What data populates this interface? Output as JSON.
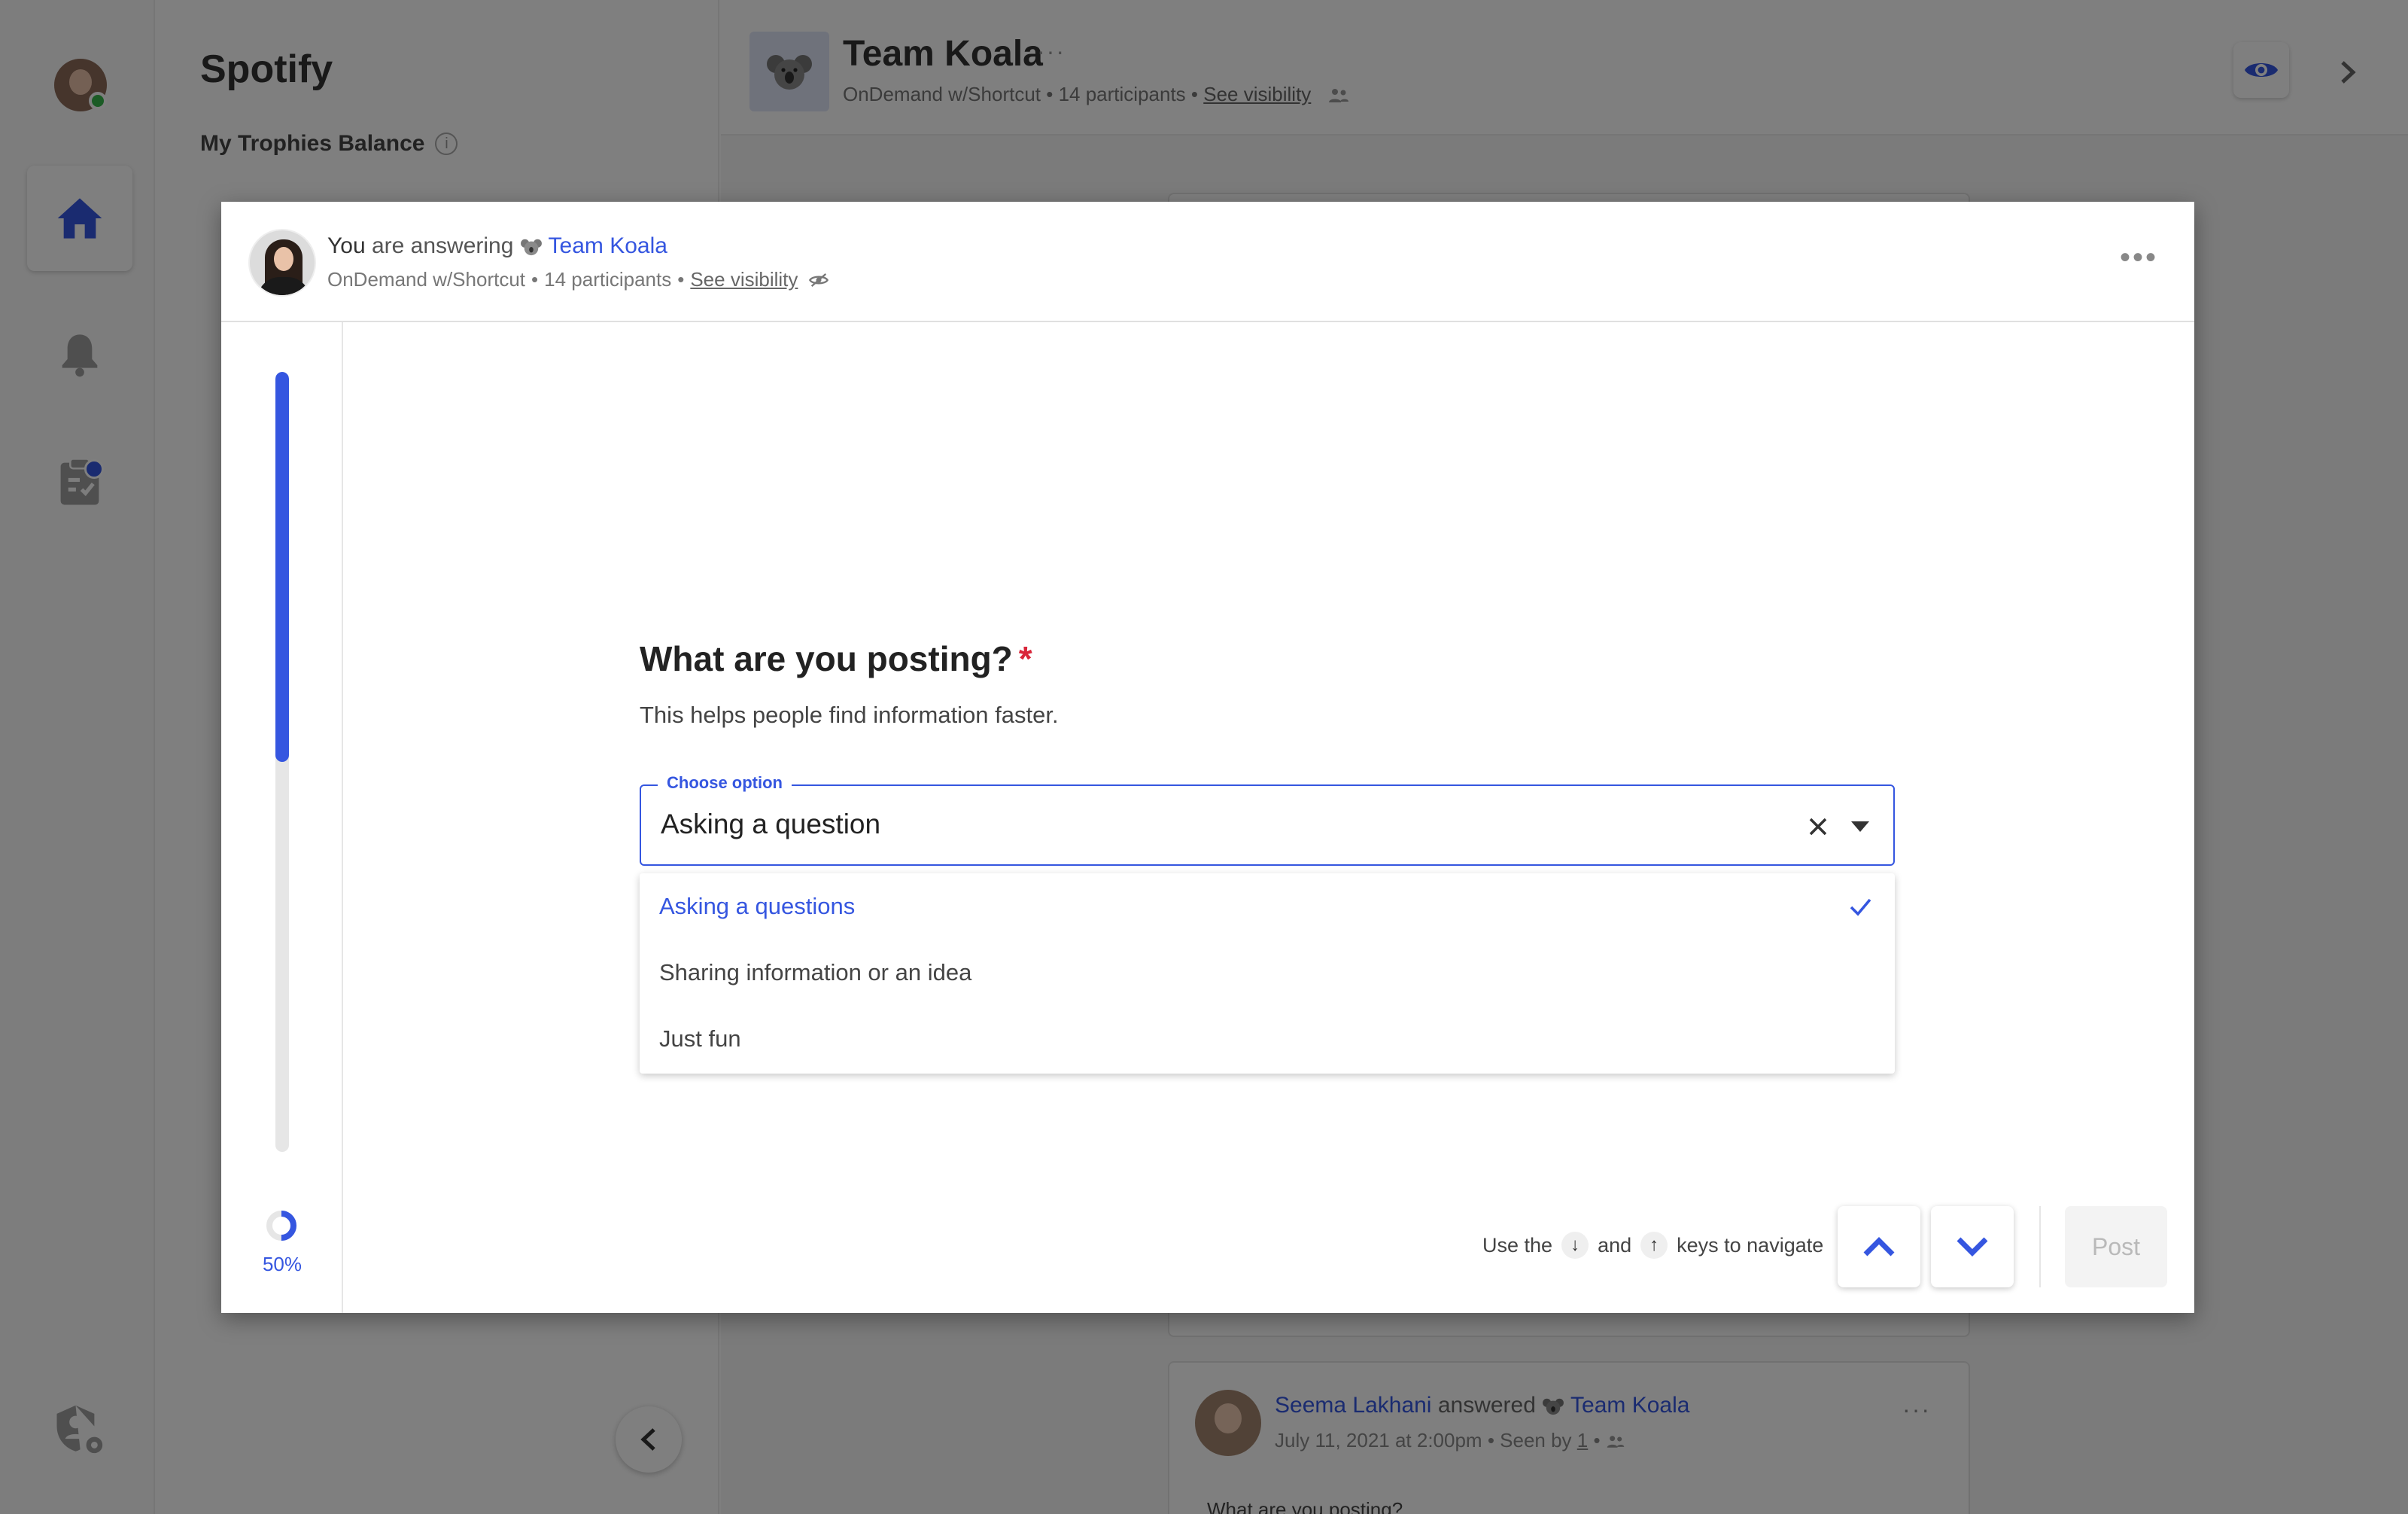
{
  "sidebar": {
    "org_name": "Spotify",
    "trophies_label": "My Trophies Balance"
  },
  "team": {
    "name": "Team Koala",
    "program": "OnDemand w/Shortcut",
    "participants": "14 participants",
    "see_visibility": "See visibility"
  },
  "feed_post": {
    "author": "Seema Lakhani",
    "verb": "answered",
    "team": "Team Koala",
    "date": "July 11, 2021 at 2:00pm",
    "seen_by": "• Seen by",
    "seen_count": "1",
    "question": "What are you posting?"
  },
  "modal": {
    "header": {
      "you": "You",
      "are_answering": "are answering",
      "team": "Team Koala",
      "program": "OnDemand w/Shortcut",
      "participants": "14 participants",
      "see_visibility": "See visibility"
    },
    "progress": {
      "percent_label": "50%",
      "value": 0.5
    },
    "question": {
      "title": "What are you posting?",
      "required_mark": "*",
      "subtitle": "This helps people find information faster."
    },
    "select": {
      "legend": "Choose option",
      "value": "Asking a question",
      "options": [
        {
          "label": "Asking a questions",
          "selected": true
        },
        {
          "label": "Sharing information or an idea",
          "selected": false
        },
        {
          "label": "Just fun",
          "selected": false
        }
      ]
    },
    "footer": {
      "hint_prefix": "Use the",
      "hint_and": "and",
      "hint_suffix": "keys to navigate",
      "post_label": "Post"
    }
  },
  "colors": {
    "accent": "#3556e0",
    "required": "#d9263a",
    "online": "#36b64a"
  }
}
